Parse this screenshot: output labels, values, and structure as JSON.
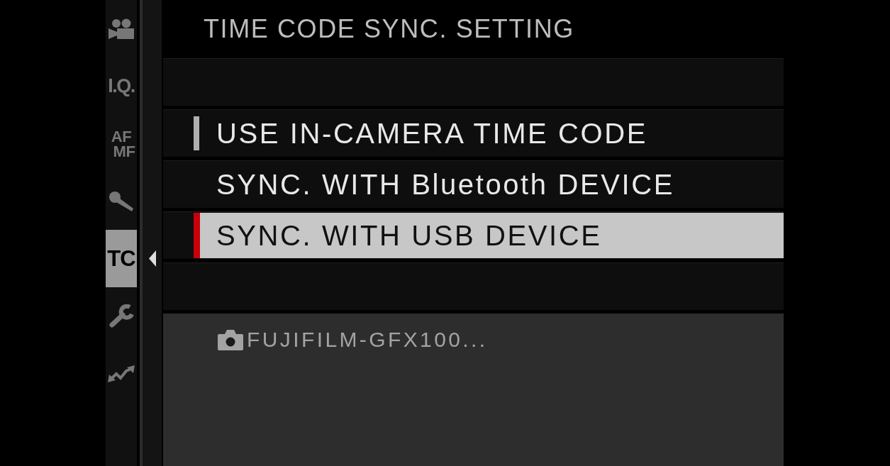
{
  "sidebar": {
    "tabs": [
      {
        "kind": "icon",
        "selected": false
      },
      {
        "kind": "text",
        "label": "I.Q.",
        "selected": false
      },
      {
        "kind": "stacked",
        "lines": [
          "AF",
          "MF"
        ],
        "selected": false
      },
      {
        "kind": "icon",
        "selected": false
      },
      {
        "kind": "text",
        "label": "TC",
        "selected": true
      },
      {
        "kind": "icon",
        "selected": false
      },
      {
        "kind": "icon",
        "selected": false
      }
    ]
  },
  "screen": {
    "title": "TIME CODE SYNC. SETTING",
    "rows": [
      {
        "kind": "blank"
      },
      {
        "kind": "option",
        "label": "USE IN-CAMERA TIME CODE",
        "selected": false,
        "current": true
      },
      {
        "kind": "option",
        "label": "SYNC. WITH Bluetooth DEVICE",
        "selected": false,
        "current": false
      },
      {
        "kind": "option",
        "label": "SYNC. WITH USB DEVICE",
        "selected": true,
        "current": false
      },
      {
        "kind": "blank"
      }
    ],
    "info": {
      "device": "FUJIFILM-GFX100..."
    }
  }
}
